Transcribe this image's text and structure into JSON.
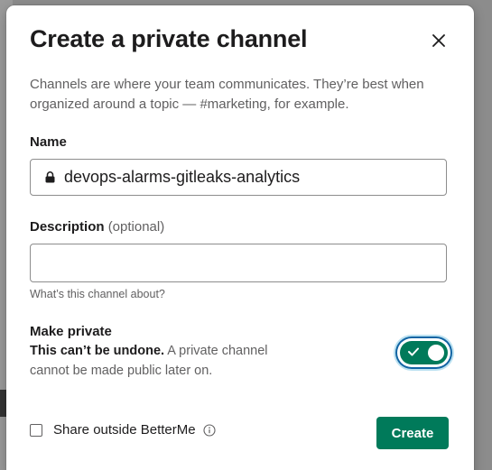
{
  "modal": {
    "title": "Create a private channel",
    "intro": "Channels are where your team communicates. They’re best when organized around a topic — #marketing, for example.",
    "close_icon": "close-icon"
  },
  "name": {
    "label": "Name",
    "value": "devops-alarms-gitleaks-analytics",
    "icon": "lock-icon"
  },
  "description": {
    "label": "Description",
    "optional": "(optional)",
    "value": "",
    "hint": "What’s this channel about?"
  },
  "privacy": {
    "label": "Make private",
    "warning_bold": "This can’t be undone.",
    "warning_rest": "A private channel cannot be made public later on.",
    "toggle_on": true
  },
  "footer": {
    "share_label": "Share outside BetterMe",
    "share_checked": false,
    "info_icon": "info-icon",
    "create_label": "Create"
  },
  "colors": {
    "primary_green": "#007a5a",
    "focus_blue": "#1264a3"
  }
}
